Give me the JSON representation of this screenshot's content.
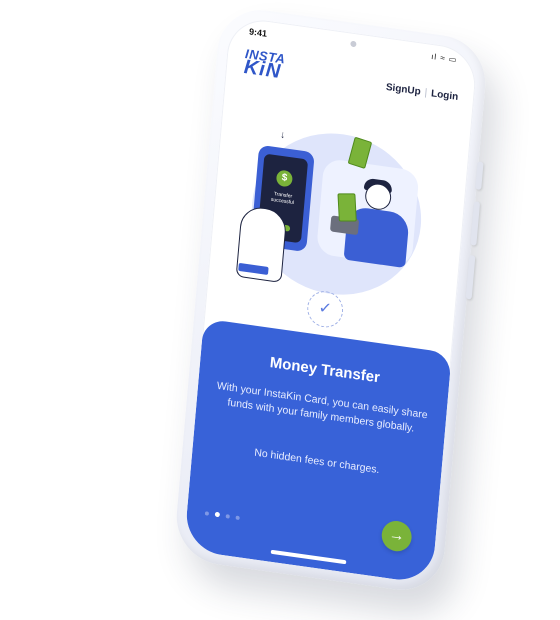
{
  "status_bar": {
    "time": "9:41",
    "icons": "ıl ≈ ▭"
  },
  "header": {
    "logo_top": "INSTA",
    "logo_bottom": "KiN",
    "signup_label": "SignUp",
    "separator": "|",
    "login_label": "Login"
  },
  "illustration": {
    "coin_symbol": "$",
    "screen_text": "Transfer successful",
    "check_symbol": "✓"
  },
  "onboarding": {
    "title": "Money Transfer",
    "body": "With your InstaKin Card, you can easily share funds with your family members globally.",
    "note": "No hidden fees or charges.",
    "page_count": 4,
    "current_page": 2,
    "next_icon": "→"
  },
  "colors": {
    "brand_blue": "#3862d8",
    "accent_green": "#7ab339",
    "dark_text": "#1d2340"
  }
}
